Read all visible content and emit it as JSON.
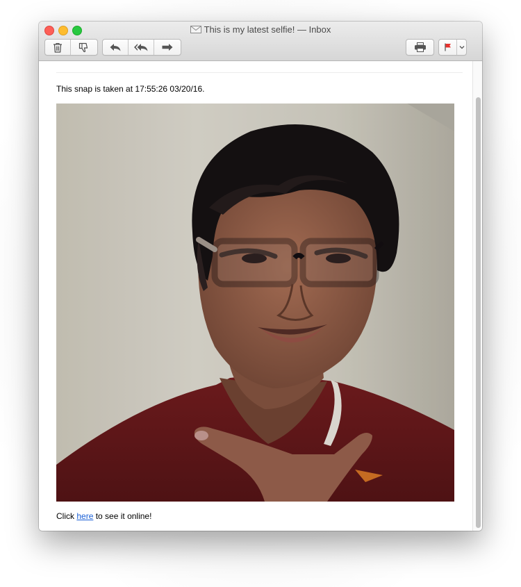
{
  "window": {
    "title": "This is my latest selfie! — Inbox"
  },
  "toolbar": {
    "icons": [
      "trash-icon",
      "junk-thumbs-down-icon",
      "reply-icon",
      "reply-all-icon",
      "forward-icon",
      "print-icon",
      "flag-icon",
      "chevron-down-icon"
    ],
    "flag_color": "#e8322e"
  },
  "message": {
    "intro": "This snap is taken at 17:55:26 03/20/16.",
    "footer_prefix": "Click ",
    "footer_link": "here",
    "footer_suffix": " to see it online!",
    "link_color": "#1a5fd6"
  }
}
